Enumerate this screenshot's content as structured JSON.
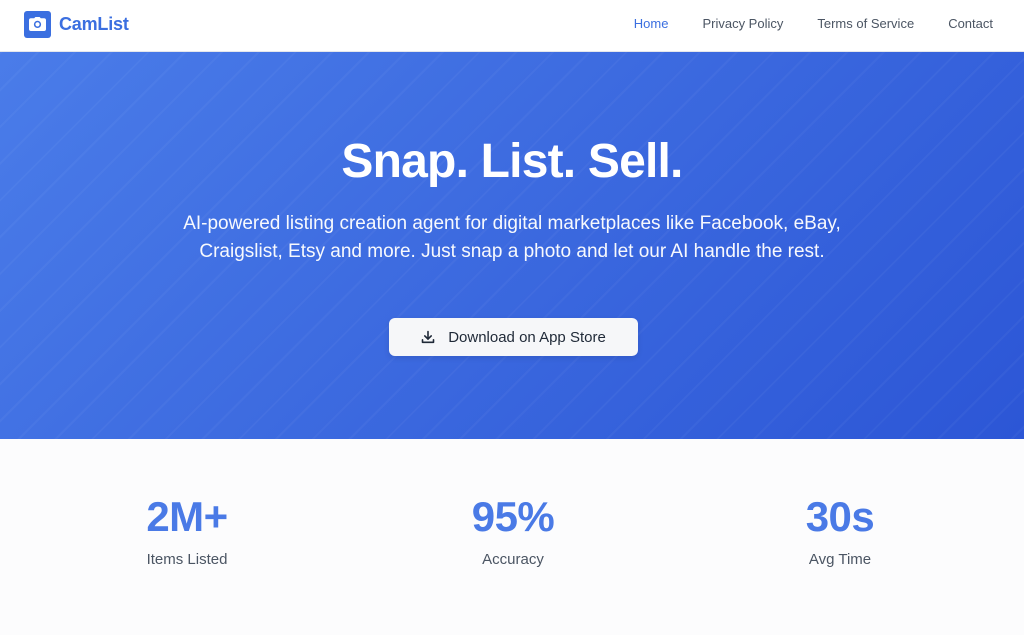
{
  "header": {
    "brand": "CamList",
    "logo_icon": "camera-icon",
    "nav": [
      {
        "label": "Home",
        "active": true
      },
      {
        "label": "Privacy Policy",
        "active": false
      },
      {
        "label": "Terms of Service",
        "active": false
      },
      {
        "label": "Contact",
        "active": false
      }
    ]
  },
  "hero": {
    "title": "Snap. List. Sell.",
    "subtitle": "AI-powered listing creation agent for digital marketplaces like Facebook, eBay, Craigslist, Etsy and more. Just snap a photo and let our AI handle the rest.",
    "cta": {
      "label": "Download on App Store",
      "icon": "download-icon"
    }
  },
  "stats": [
    {
      "value": "2M+",
      "label": "Items Listed"
    },
    {
      "value": "95%",
      "label": "Accuracy"
    },
    {
      "value": "30s",
      "label": "Avg Time"
    }
  ],
  "colors": {
    "brand": "#3b6fe0",
    "hero_start": "#4a7ce9",
    "hero_end": "#2c56d6",
    "stat_value": "#4a7ae6",
    "button_bg": "#f6f7f9"
  }
}
